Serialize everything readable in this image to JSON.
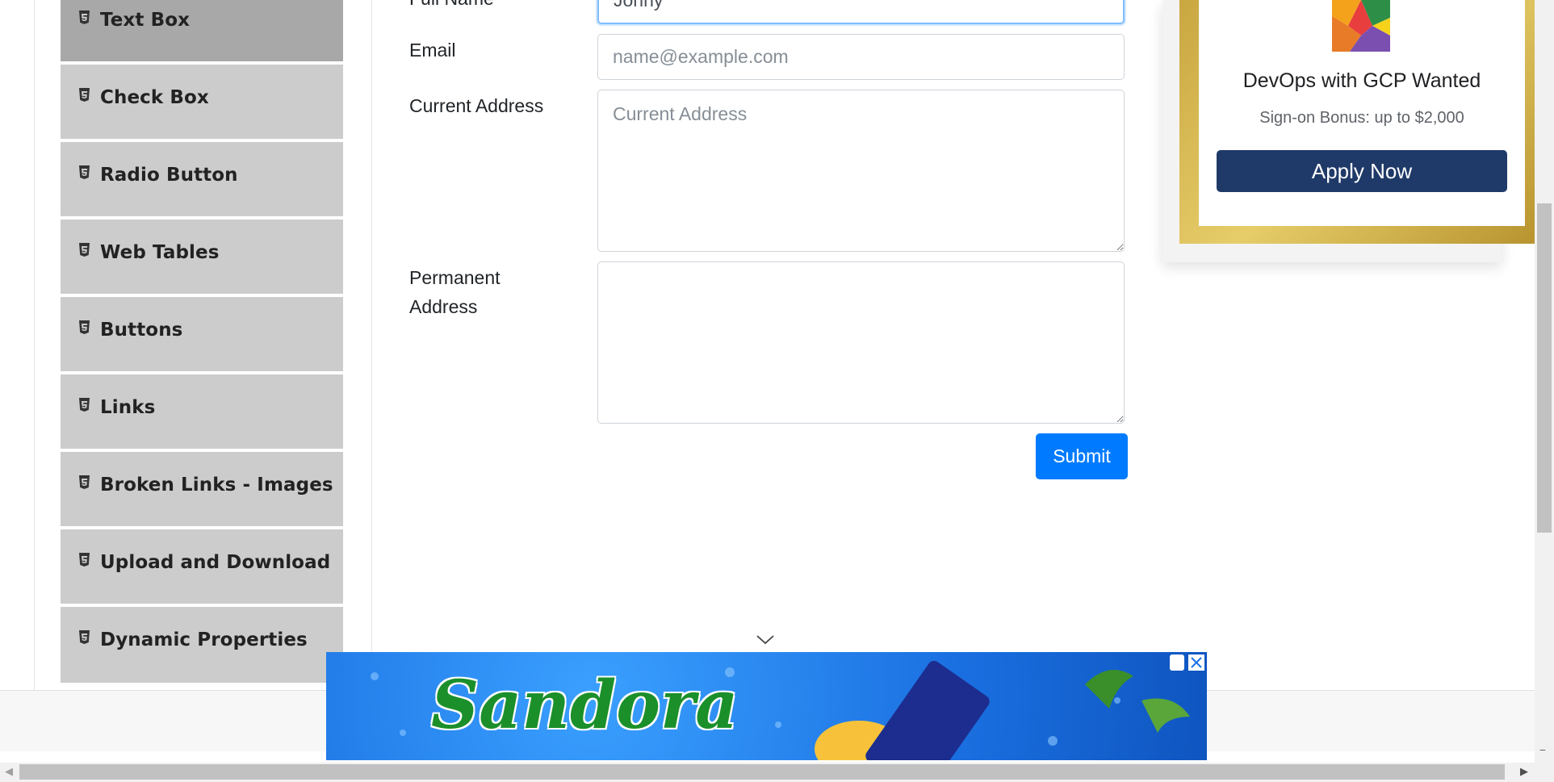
{
  "sidebar": {
    "items": [
      {
        "label": "Text Box"
      },
      {
        "label": "Check Box"
      },
      {
        "label": "Radio Button"
      },
      {
        "label": "Web Tables"
      },
      {
        "label": "Buttons"
      },
      {
        "label": "Links"
      },
      {
        "label": "Broken Links - Images"
      },
      {
        "label": "Upload and Download"
      },
      {
        "label": "Dynamic Properties"
      }
    ],
    "active_index": 0
  },
  "form": {
    "full_name_label": "Full Name",
    "full_name_value": "Johny",
    "email_label": "Email",
    "email_placeholder": "name@example.com",
    "current_address_label": "Current Address",
    "current_address_placeholder": "Current Address",
    "permanent_address_label_line1": "Permanent",
    "permanent_address_label_line2": "Address",
    "submit_label": "Submit"
  },
  "ad": {
    "title": "DevOps with GCP Wanted",
    "subtitle": "Sign-on Bonus: up to $2,000",
    "button_label": "Apply Now"
  },
  "banner": {
    "brand": "Sandora"
  },
  "colors": {
    "primary": "#007bff",
    "sidebar_bg": "#cccccc",
    "sidebar_active_bg": "#a8a8a8",
    "ad_button": "#1f3a68"
  }
}
